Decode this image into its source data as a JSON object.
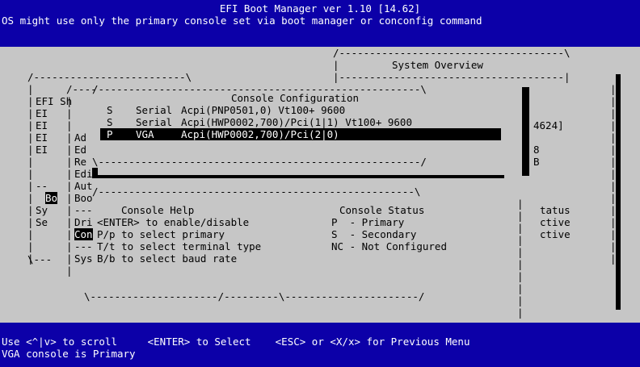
{
  "header": {
    "title": "EFI Boot Manager ver 1.10 [14.62]",
    "subtitle": "OS might use only the primary console set via boot manager or conconfig command"
  },
  "footer": {
    "hints": "Use <^|v> to scroll     <ENTER> to Select    <ESC> or <X/x> for Previous Menu",
    "status": "VGA console is Primary"
  },
  "boot_menu": {
    "items": [
      "EFI Sh",
      "EI",
      "EI",
      "EI",
      "EI",
      "",
      "",
      "Bo",
      "Sy",
      "Se"
    ]
  },
  "system_overview": {
    "title": "System Overview",
    "values": [
      "4624]",
      "8",
      "B"
    ],
    "status_lines": [
      "tatus",
      "ctive",
      "ctive"
    ]
  },
  "submenu": {
    "items": [
      "Ad",
      "Ed",
      "Re",
      "Edit",
      "Aut",
      "Boo",
      "---",
      "Dri",
      "Con",
      "---",
      "Sys"
    ]
  },
  "console_configuration": {
    "title": "Console Configuration",
    "entries": [
      {
        "flag": "S",
        "name": "Serial",
        "path": "Acpi(PNP0501,0) Vt100+ 9600"
      },
      {
        "flag": "S",
        "name": "Serial",
        "path": "Acpi(HWP0002,700)/Pci(1|1) Vt100+ 9600"
      },
      {
        "flag": "P",
        "name": "VGA",
        "path": "Acpi(HWP0002,700)/Pci(2|0)"
      }
    ]
  },
  "console_help": {
    "title": "Console Help",
    "lines": [
      "<ENTER> to enable/disable",
      "P/p to select primary",
      "T/t to select terminal type",
      "B/b to select baud rate"
    ]
  },
  "console_status": {
    "title": "Console Status",
    "lines": [
      "P  - Primary",
      "S  - Secondary",
      "NC - Not Configured"
    ]
  },
  "colors": {
    "background": "#0c00a8",
    "panel": "#c6c6c6",
    "text": "#000000",
    "highlight_bg": "#000000",
    "highlight_fg": "#ffffff"
  }
}
